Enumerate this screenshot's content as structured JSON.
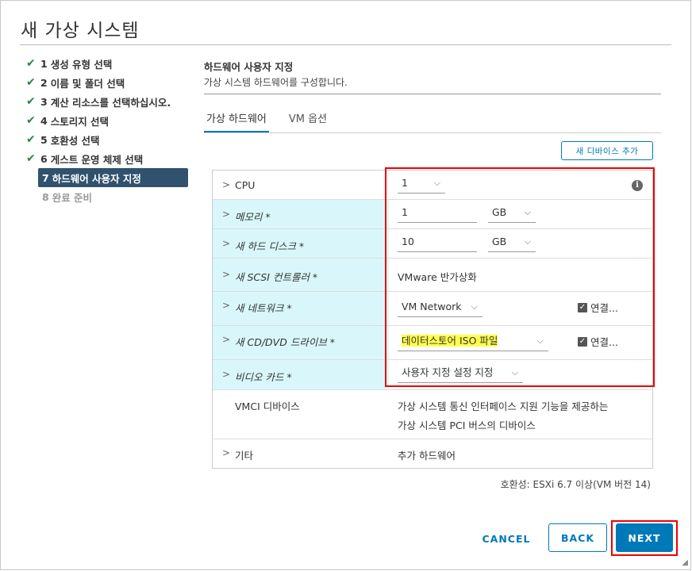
{
  "window": {
    "title": "새 가상 시스템"
  },
  "steps": [
    {
      "num": "1",
      "label": "생성 유형 선택"
    },
    {
      "num": "2",
      "label": "이름 및 폴더 선택"
    },
    {
      "num": "3",
      "label": "계산 리소스를 선택하십시오."
    },
    {
      "num": "4",
      "label": "스토리지 선택"
    },
    {
      "num": "5",
      "label": "호환성 선택"
    },
    {
      "num": "6",
      "label": "게스트 운영 체제 선택"
    },
    {
      "num": "7",
      "label": "하드웨어 사용자 지정"
    },
    {
      "num": "8",
      "label": "완료 준비"
    }
  ],
  "header": {
    "title": "하드웨어 사용자 지정",
    "subtitle": "가상 시스템 하드웨어를 구성합니다."
  },
  "tabs": [
    {
      "label": "가상 하드웨어"
    },
    {
      "label": "VM 옵션"
    }
  ],
  "add_device_label": "새 디바이스 추가",
  "hardware": {
    "cpu": {
      "label": "CPU",
      "value": "1"
    },
    "memory": {
      "label": "메모리 *",
      "value": "1",
      "unit": "GB"
    },
    "disk": {
      "label": "새 하드 디스크 *",
      "value": "10",
      "unit": "GB"
    },
    "scsi": {
      "label": "새 SCSI 컨트롤러 *",
      "value": "VMware 반가상화"
    },
    "network": {
      "label": "새 네트워크 *",
      "value": "VM Network",
      "connect": "연결..."
    },
    "cddvd": {
      "label": "새 CD/DVD 드라이브 *",
      "value": "데이터스토어 ISO 파일",
      "connect": "연결..."
    },
    "video": {
      "label": "비디오 카드 *",
      "value": "사용자 지정 설정 지정"
    },
    "vmci": {
      "label": "VMCI 디바이스",
      "line1": "가상 시스템 통신 인터페이스 지원 기능을 제공하는",
      "line2": "가상 시스템 PCI 버스의 디바이스"
    },
    "other": {
      "label": "기타",
      "value": "추가 하드웨어"
    }
  },
  "compatibility": "호환성: ESXi 6.7 이상(VM 버전 14)",
  "buttons": {
    "cancel": "CANCEL",
    "back": "BACK",
    "next": "NEXT"
  },
  "colors": {
    "accent": "#0079b8",
    "active_step": "#30526e",
    "highlight_row": "#d9f7fa",
    "annotation": "#ee0000"
  }
}
